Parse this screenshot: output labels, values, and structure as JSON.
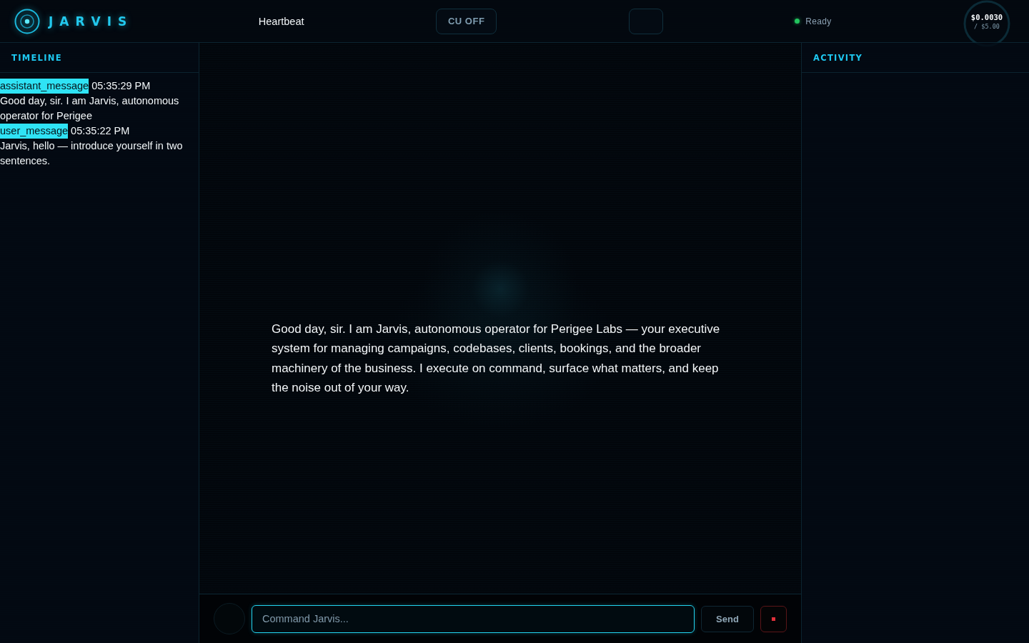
{
  "header": {
    "logo": {
      "text": "JARVIS"
    },
    "mode": "Heartbeat",
    "cu_button": "CU OFF",
    "status": {
      "label": "Ready",
      "online": true
    },
    "cost": {
      "spent": "$0.0030",
      "budget": "/ $5.00"
    }
  },
  "timeline": {
    "title": "TIMELINE",
    "events": [
      {
        "tag": "assistant_message",
        "time": "05:35:29 PM",
        "text": "Good day, sir. I am Jarvis, autonomous operator for Perigee"
      },
      {
        "tag": "user_message",
        "time": "05:35:22 PM",
        "text": "Jarvis, hello — introduce yourself in two sentences."
      }
    ]
  },
  "conversation": {
    "message": "Good day, sir. I am Jarvis, autonomous operator for Perigee Labs — your executive system for managing campaigns, codebases, clients, bookings, and the broader machinery of the business. I execute on command, surface what matters, and keep the noise out of your way."
  },
  "activity": {
    "title": "ACTIVITY"
  },
  "composer": {
    "placeholder": "Command Jarvis...",
    "send": "Send"
  }
}
